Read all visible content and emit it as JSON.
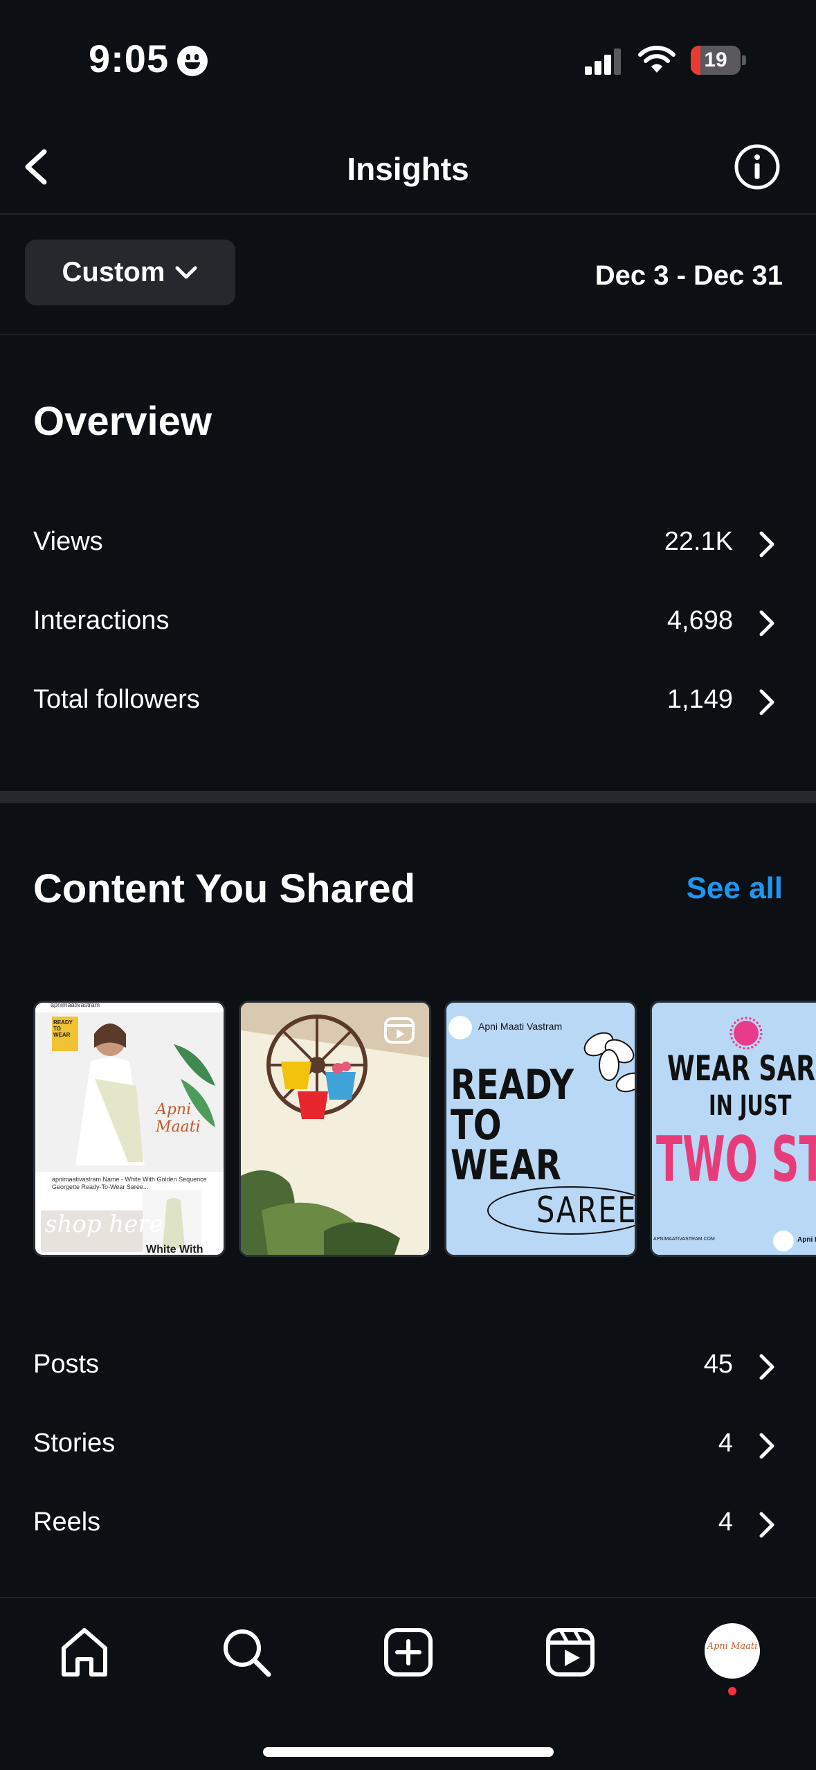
{
  "status_bar": {
    "time": "9:05",
    "battery": "19",
    "battery_level": 0.19
  },
  "header": {
    "title": "Insights"
  },
  "range": {
    "button_label": "Custom",
    "date_range": "Dec 3 - Dec 31"
  },
  "overview": {
    "title": "Overview",
    "rows": [
      {
        "label": "Views",
        "value": "22.1K"
      },
      {
        "label": "Interactions",
        "value": "4,698"
      },
      {
        "label": "Total followers",
        "value": "1,149"
      }
    ]
  },
  "content": {
    "title": "Content You Shared",
    "see_all": "See all",
    "thumbnails": [
      {
        "handle": "apnimaativastram",
        "badge": "READY TO WEAR",
        "brand": "Apni Maati",
        "caption": "apnimaativastram Name - White With Golden Sequence Georgette Ready-To-Wear Saree...",
        "overlay": "shop here",
        "footer": "White With"
      },
      {
        "icon": "reel-icon"
      },
      {
        "brand": "Apni Maati Vastram",
        "headline_1": "READY",
        "headline_2": "TO",
        "headline_3": "WEAR",
        "script": "SAREE"
      },
      {
        "headline_1": "WEAR SAREE",
        "headline_2": "IN JUST",
        "headline_3": "TWO STEPS",
        "url": "APNIMAATIVASTRAM.COM",
        "brand": "Apni M"
      }
    ],
    "rows": [
      {
        "label": "Posts",
        "value": "45"
      },
      {
        "label": "Stories",
        "value": "4"
      },
      {
        "label": "Reels",
        "value": "4"
      }
    ]
  },
  "nav": {
    "items": [
      "home-icon",
      "search-icon",
      "create-icon",
      "reels-icon",
      "profile-avatar"
    ],
    "avatar_text": "Apni Maati",
    "notification_color": "#ff3040"
  }
}
